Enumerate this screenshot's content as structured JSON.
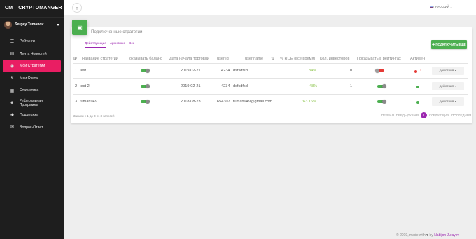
{
  "brand": {
    "short": "CM",
    "name": "CRYPTOMANGER"
  },
  "user": {
    "name": "Sergey Tumanov"
  },
  "sidebar": {
    "items": [
      {
        "label": "Рейтинги",
        "icon": "list-icon"
      },
      {
        "label": "Лента Новостей",
        "icon": "news-icon"
      },
      {
        "label": "Мои Стратегии",
        "icon": "strategy-icon",
        "active": true
      },
      {
        "label": "Мои Счета",
        "icon": "euro-icon"
      },
      {
        "label": "Статистика",
        "icon": "stats-icon"
      },
      {
        "label": "Реферальная Программа",
        "icon": "people-icon"
      },
      {
        "label": "Поддержка",
        "icon": "support-icon"
      },
      {
        "label": "Вопрос-Ответ",
        "icon": "chat-icon"
      }
    ]
  },
  "topbar": {
    "language": "РУССКИЙ"
  },
  "card": {
    "title": "Подключенные стратегии",
    "tabs": [
      "Действующие",
      "Архивные",
      "Все"
    ],
    "connect_button": "ПОДКЛЮЧИТЬ ЕЩЁ"
  },
  "table": {
    "headers": {
      "num": "#",
      "name": "Название стратегии",
      "balance": "Показывать баланс",
      "start_date": "Дата начала торговли",
      "user_id": "user.Id",
      "user_name": "user.name",
      "roe": "% ROE (все время)",
      "investors": "Кол. инвесторов",
      "rating": "Показывать в рейтингах",
      "active": "Активен"
    },
    "rows": [
      {
        "num": "1",
        "name": "test",
        "start_date": "2019-02-21",
        "user_id": "4234",
        "user_name": "dsfsdfsd",
        "roe": "34%",
        "investors": "0",
        "balance_on": true,
        "rating_on": false,
        "active_color": "#e53935",
        "arrow": "↑",
        "action": "действия"
      },
      {
        "num": "2",
        "name": "test 2",
        "start_date": "2019-02-21",
        "user_id": "4234",
        "user_name": "dsfsdfsd",
        "roe": "48%",
        "investors": "1",
        "balance_on": true,
        "rating_on": true,
        "active_color": "#4caf50",
        "arrow": "",
        "action": "действия"
      },
      {
        "num": "3",
        "name": "tuman949",
        "start_date": "2018-08-23",
        "user_id": "654307",
        "user_name": "tuman949@gmail.com",
        "roe": "763.16%",
        "investors": "1",
        "balance_on": true,
        "rating_on": true,
        "active_color": "#4caf50",
        "arrow": "",
        "action": "действия"
      }
    ],
    "info": "Записи с 1 до 3 из 3 записей",
    "pager": {
      "first": "ПЕРВАЯ",
      "prev": "ПРЕДЫДУЩАЯ",
      "page": "1",
      "next": "СЛЕДУЮЩАЯ",
      "last": "ПОСЛЕДНЯЯ"
    }
  },
  "footer": {
    "text": "© 2019, made with",
    "by": "by",
    "author": "Nabijon Jurayev"
  }
}
